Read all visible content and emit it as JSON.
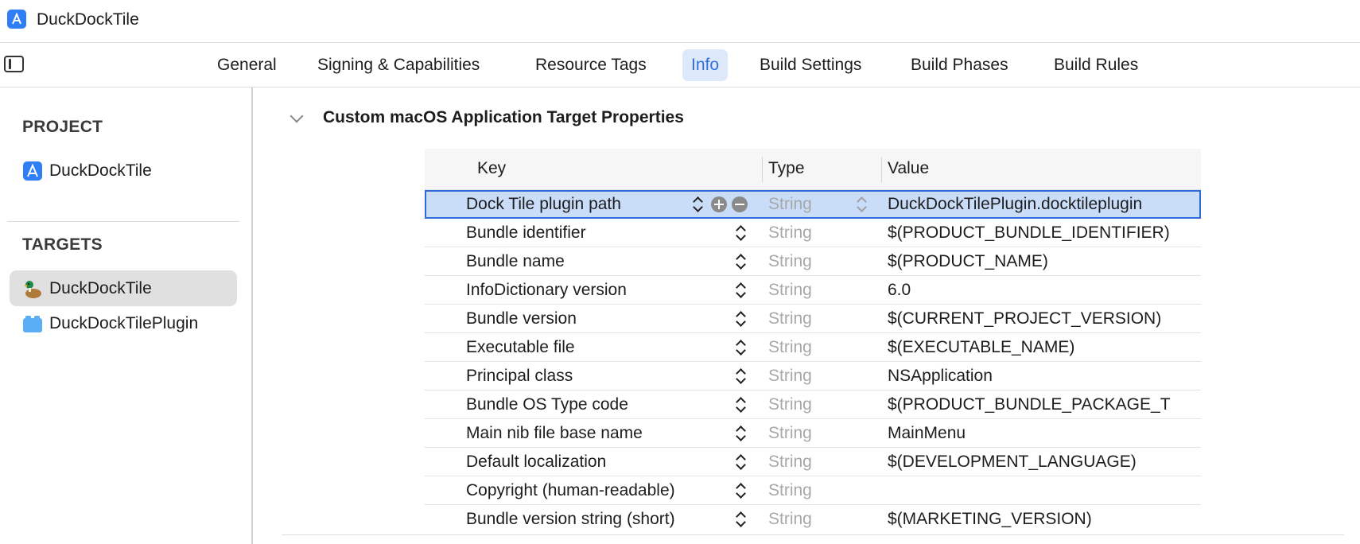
{
  "window": {
    "title": "DuckDockTile"
  },
  "tabs": [
    {
      "label": "General"
    },
    {
      "label": "Signing & Capabilities"
    },
    {
      "label": "Resource Tags"
    },
    {
      "label": "Info",
      "active": true
    },
    {
      "label": "Build Settings"
    },
    {
      "label": "Build Phases"
    },
    {
      "label": "Build Rules"
    }
  ],
  "sidebar": {
    "project_header": "PROJECT",
    "project_item": "DuckDockTile",
    "targets_header": "TARGETS",
    "targets": [
      {
        "label": "DuckDockTile",
        "icon": "duck-icon",
        "selected": true
      },
      {
        "label": "DuckDockTilePlugin",
        "icon": "bundle-icon",
        "selected": false
      }
    ]
  },
  "section": {
    "title": "Custom macOS Application Target Properties"
  },
  "table": {
    "headers": {
      "key": "Key",
      "type": "Type",
      "value": "Value"
    },
    "rows": [
      {
        "key": "Dock Tile plugin path",
        "type": "String",
        "value": "DuckDockTilePlugin.docktileplugin",
        "selected": true
      },
      {
        "key": "Bundle identifier",
        "type": "String",
        "value": "$(PRODUCT_BUNDLE_IDENTIFIER)"
      },
      {
        "key": "Bundle name",
        "type": "String",
        "value": "$(PRODUCT_NAME)"
      },
      {
        "key": "InfoDictionary version",
        "type": "String",
        "value": "6.0"
      },
      {
        "key": "Bundle version",
        "type": "String",
        "value": "$(CURRENT_PROJECT_VERSION)"
      },
      {
        "key": "Executable file",
        "type": "String",
        "value": "$(EXECUTABLE_NAME)"
      },
      {
        "key": "Principal class",
        "type": "String",
        "value": "NSApplication"
      },
      {
        "key": "Bundle OS Type code",
        "type": "String",
        "value": "$(PRODUCT_BUNDLE_PACKAGE_T"
      },
      {
        "key": "Main nib file base name",
        "type": "String",
        "value": "MainMenu"
      },
      {
        "key": "Default localization",
        "type": "String",
        "value": "$(DEVELOPMENT_LANGUAGE)"
      },
      {
        "key": "Copyright (human-readable)",
        "type": "String",
        "value": ""
      },
      {
        "key": "Bundle version string (short)",
        "type": "String",
        "value": "$(MARKETING_VERSION)"
      }
    ]
  },
  "colors": {
    "accent": "#2f6fe0",
    "selection": "#c9dcf8",
    "tab_active_bg": "#dde9fb"
  }
}
